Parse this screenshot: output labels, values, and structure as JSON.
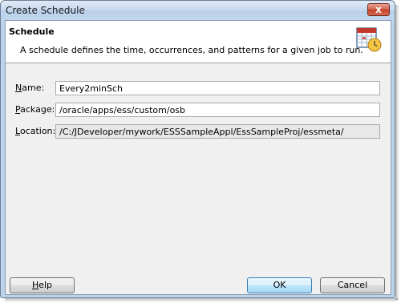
{
  "window": {
    "title": "Create Schedule",
    "close_glyph": "x"
  },
  "header": {
    "title": "Schedule",
    "description": "A schedule defines the time, occurrences, and patterns for a given job to run.",
    "icon": "calendar-clock-icon"
  },
  "form": {
    "name": {
      "label_accel": "N",
      "label_rest": "ame:",
      "value": "Every2minSch"
    },
    "package": {
      "label_accel": "P",
      "label_rest": "ackage:",
      "value": "/oracle/apps/ess/custom/osb"
    },
    "location": {
      "label_accel": "L",
      "label_rest": "ocation:",
      "value": "/C:/JDeveloper/mywork/ESSSampleAppl/EssSampleProj/essmeta/"
    }
  },
  "buttons": {
    "help": {
      "accel": "H",
      "rest": "elp"
    },
    "ok": "OK",
    "cancel": "Cancel"
  },
  "colors": {
    "accent": "#3c7fb1",
    "titlebar": "#c6d9ef",
    "close": "#c24129"
  }
}
